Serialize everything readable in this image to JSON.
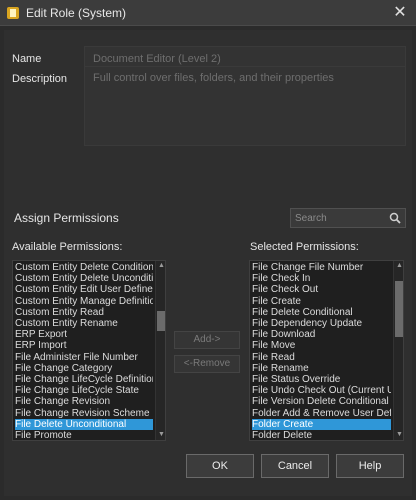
{
  "window": {
    "title": "Edit Role (System)",
    "close_glyph": "✕"
  },
  "form": {
    "name_label": "Name",
    "name_value": "Document Editor (Level 2)",
    "description_label": "Description",
    "description_value": "Full control over files, folders, and their properties"
  },
  "permissions": {
    "section_title": "Assign Permissions",
    "search_placeholder": "Search",
    "available_label": "Available Permissions:",
    "selected_label": "Selected Permissions:",
    "add_label": "Add->",
    "remove_label": "<-Remove",
    "available": [
      "Custom Entity Delete Conditional",
      "Custom Entity Delete Unconditional",
      "Custom Entity Edit User Defined Properties",
      "Custom Entity Manage Definitions",
      "Custom Entity Read",
      "Custom Entity Rename",
      "ERP Export",
      "ERP Import",
      "File Administer File Number",
      "File Change Category",
      "File Change LifeCycle Definition",
      "File Change LifeCycle State",
      "File Change Revision",
      "File Change Revision Scheme",
      "File Delete Unconditional",
      "File Promote"
    ],
    "available_selected_index": 14,
    "selected": [
      "File Change File Number",
      "File Check In",
      "File Check Out",
      "File Create",
      "File Delete Conditional",
      "File Dependency Update",
      "File Download",
      "File Move",
      "File Read",
      "File Rename",
      "File Status Override",
      "File Undo Check Out (Current User)",
      "File Version Delete Conditional",
      "Folder Add & Remove User Defined Properties",
      "Folder Create",
      "Folder Delete"
    ],
    "selected_selected_index": 14
  },
  "buttons": {
    "ok": "OK",
    "cancel": "Cancel",
    "help": "Help"
  },
  "colors": {
    "selection": "#2f97d8",
    "background": "#2b2b2b"
  },
  "icons": {
    "app": "app-icon",
    "close": "close-icon",
    "search": "search-icon"
  }
}
